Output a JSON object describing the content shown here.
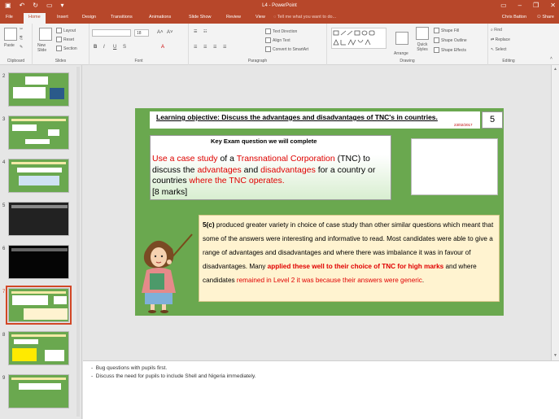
{
  "app": {
    "title": "L4 - PowerPoint",
    "user": "Chris Batton",
    "share": "Share",
    "accent": "#b7472a"
  },
  "ribbon_tabs": [
    "File",
    "Home",
    "Insert",
    "Design",
    "Transitions",
    "Animations",
    "Slide Show",
    "Review",
    "View"
  ],
  "active_tab": "Home",
  "tell_me": "Tell me what you want to do...",
  "ribbon": {
    "clipboard": {
      "paste": "Paste",
      "label": "Clipboard"
    },
    "slides": {
      "new_slide": "New Slide",
      "layout": "Layout",
      "reset": "Reset",
      "section": "Section",
      "label": "Slides"
    },
    "font": {
      "size": "18",
      "label": "Font"
    },
    "paragraph": {
      "text_direction": "Text Direction",
      "align_text": "Align Text",
      "smartart": "Convert to SmartArt",
      "label": "Paragraph"
    },
    "drawing": {
      "arrange": "Arrange",
      "quick_styles": "Quick Styles",
      "shape_fill": "Shape Fill",
      "shape_outline": "Shape Outline",
      "shape_effects": "Shape Effects",
      "label": "Drawing"
    },
    "editing": {
      "find": "Find",
      "replace": "Replace",
      "select": "Select",
      "label": "Editing"
    }
  },
  "thumbnails": [
    {
      "num": "2",
      "style": "green"
    },
    {
      "num": "3",
      "style": "green"
    },
    {
      "num": "4",
      "style": "green"
    },
    {
      "num": "5",
      "style": "dark"
    },
    {
      "num": "6",
      "style": "black"
    },
    {
      "num": "7",
      "style": "green",
      "selected": true
    },
    {
      "num": "8",
      "style": "green"
    },
    {
      "num": "9",
      "style": "green"
    }
  ],
  "slide": {
    "objective": "Learning objective:  Discuss the advantages and disadvantages of TNC's in countries.",
    "date": "23/02/2017",
    "lesson_number": "5",
    "key_exam_title": "Key Exam question we will complete",
    "question": {
      "p1": "Use a case study",
      "p2": " of a ",
      "p3": "Transnational Corporation",
      "p4": " (TNC) to discuss the ",
      "p5": "advantages",
      "p6": " and ",
      "p7": "disadvantages",
      "p8": " for a country or countries ",
      "p9": "where the TNC operates.",
      "p10": "[8 marks]"
    },
    "examiner": {
      "code": "5(c)",
      "t1": " produced greater variety in choice of case study than other similar questions which meant that some of the answers were interesting and informative to read. Most candidates were able to give a range of advantages and disadvantages and where there was imbalance it was in favour of disadvantages. Many ",
      "t2": "applied these well to their choice of TNC for high marks",
      "t3": " and where candidates ",
      "t4": "remained in Level 2 it was because their answers were generic",
      "t5": "."
    }
  },
  "notes": [
    "Bug questions with pupils first.",
    "Discuss the need for pupils to include Shell and Nigeria immediately."
  ]
}
